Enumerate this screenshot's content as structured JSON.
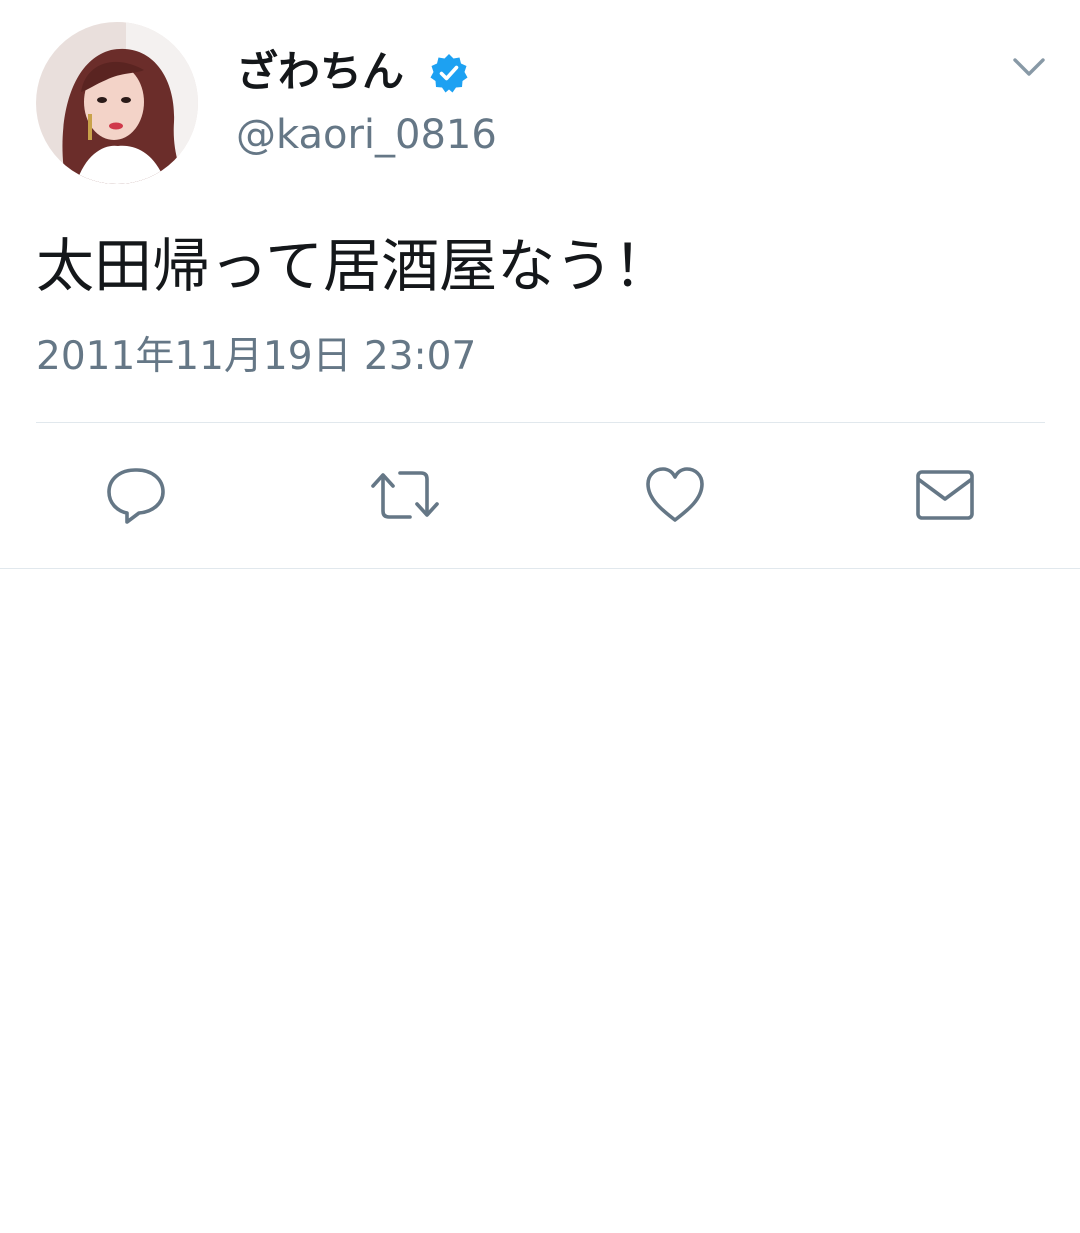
{
  "tweet": {
    "display_name": "ざわちん",
    "handle": "@kaori_0816",
    "text": "太田帰って居酒屋なう！",
    "timestamp": "2011年11月19日 23:07",
    "verified": true
  },
  "icons": {
    "avatar": "avatar-photo",
    "verified": "verified-badge-icon",
    "caret": "chevron-down-icon",
    "reply": "reply-icon",
    "retweet": "retweet-icon",
    "like": "heart-icon",
    "dm": "mail-icon"
  },
  "colors": {
    "text": "#14171a",
    "secondary": "#657786",
    "verified": "#1da1f2",
    "divider": "#e1e8ed",
    "icon": "#657786"
  }
}
